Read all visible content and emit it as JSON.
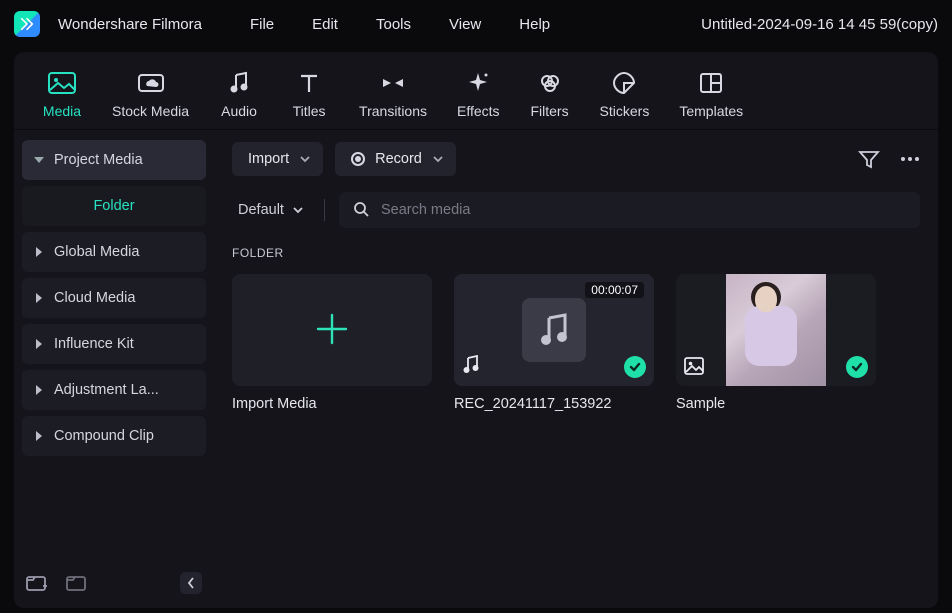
{
  "app": {
    "title": "Wondershare Filmora",
    "project_name": "Untitled-2024-09-16 14 45 59(copy)"
  },
  "menu": {
    "file": "File",
    "edit": "Edit",
    "tools": "Tools",
    "view": "View",
    "help": "Help"
  },
  "tabs": {
    "media": "Media",
    "stock": "Stock Media",
    "audio": "Audio",
    "titles": "Titles",
    "transitions": "Transitions",
    "effects": "Effects",
    "filters": "Filters",
    "stickers": "Stickers",
    "templates": "Templates"
  },
  "sidebar": {
    "project_media": "Project Media",
    "folder": "Folder",
    "global_media": "Global Media",
    "cloud_media": "Cloud Media",
    "influence_kit": "Influence Kit",
    "adjustment_layer": "Adjustment La...",
    "compound_clip": "Compound Clip"
  },
  "toolbar": {
    "import_label": "Import",
    "record_label": "Record",
    "sort_label": "Default",
    "search_placeholder": "Search media"
  },
  "section": {
    "folder_label": "FOLDER"
  },
  "cards": {
    "import_label": "Import Media",
    "audio_label": "REC_20241117_153922",
    "audio_duration": "00:00:07",
    "image_label": "Sample"
  }
}
